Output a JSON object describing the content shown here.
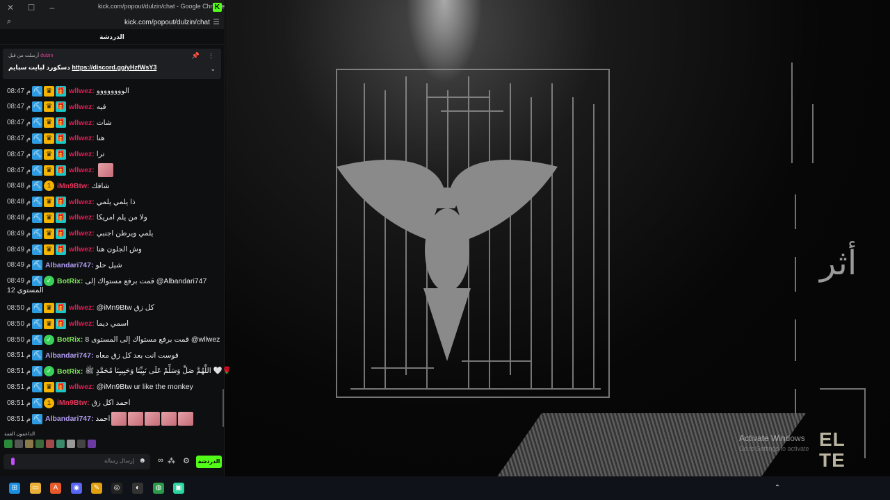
{
  "window": {
    "title": "kick.com/popout/dulzin/chat - Google Chrome",
    "url": "kick.com/popout/dulzin/chat"
  },
  "chat": {
    "header": "الدردشة",
    "pinned": {
      "by_label": "أرسلت من قبل",
      "by_user": "dulzin",
      "text": "دسكورد لبايت سبايم",
      "link": "https://discord.gg/yHzfWsY3"
    },
    "messages": [
      {
        "time": "08:47 م",
        "user": "wllwez",
        "text": "الوووووووو",
        "badges": [
          "pick",
          "crown",
          "gift"
        ]
      },
      {
        "time": "08:47 م",
        "user": "wllwez",
        "text": "فيه",
        "badges": [
          "pick",
          "crown",
          "gift"
        ]
      },
      {
        "time": "08:47 م",
        "user": "wllwez",
        "text": "شات",
        "badges": [
          "pick",
          "crown",
          "gift"
        ]
      },
      {
        "time": "08:47 م",
        "user": "wllwez",
        "text": "هنا",
        "badges": [
          "pick",
          "crown",
          "gift"
        ]
      },
      {
        "time": "08:47 م",
        "user": "wllwez",
        "text": "ترا",
        "badges": [
          "pick",
          "crown",
          "gift"
        ]
      },
      {
        "time": "08:47 م",
        "user": "wllwez",
        "text": "",
        "badges": [
          "pick",
          "crown",
          "gift"
        ],
        "emotes": 1
      },
      {
        "time": "08:48 م",
        "user": "iMn9Btw",
        "text": "شافك",
        "badges": [
          "pick",
          "coin"
        ]
      },
      {
        "time": "08:48 م",
        "user": "wllwez",
        "text": "ذا يلمي يلمي",
        "badges": [
          "pick",
          "crown",
          "gift"
        ]
      },
      {
        "time": "08:48 م",
        "user": "wllwez",
        "text": "ولا من يلم امريكا",
        "badges": [
          "pick",
          "crown",
          "gift"
        ]
      },
      {
        "time": "08:49 م",
        "user": "wllwez",
        "text": "يلمي ويرطن اجنبي",
        "badges": [
          "pick",
          "crown",
          "gift"
        ]
      },
      {
        "time": "08:49 م",
        "user": "wllwez",
        "text": "وش الجلون هنا",
        "badges": [
          "pick",
          "crown",
          "gift"
        ]
      },
      {
        "time": "08:49 م",
        "user": "Albandari747",
        "text": "شيل حلو",
        "badges": [
          "pick"
        ]
      },
      {
        "time": "08:49 م",
        "user": "BotRix",
        "text": "قمت برفع مستواك إلى @Albandari747",
        "text2": "المستوى 12",
        "badges": [
          "pick",
          "verified"
        ]
      },
      {
        "time": "08:50 م",
        "user": "wllwez",
        "text": "@iMn9Btw كل زق",
        "badges": [
          "pick",
          "crown",
          "gift"
        ]
      },
      {
        "time": "08:50 م",
        "user": "wllwez",
        "text": "اسمي ديما",
        "badges": [
          "pick",
          "crown",
          "gift"
        ]
      },
      {
        "time": "08:50 م",
        "user": "BotRix",
        "text": "قمت برفع مستواك إلى المستوى 8 @wllwez",
        "badges": [
          "pick",
          "verified"
        ]
      },
      {
        "time": "08:51 م",
        "user": "Albandari747",
        "text": "قوست انت بعد كل زق معاه",
        "badges": [
          "pick"
        ]
      },
      {
        "time": "08:51 م",
        "user": "BotRix",
        "text": "اللَّهُمَّ صَلِّ وَسَلِّمْ عَلَى نَبِيِّنَا وَحَبِيبِنَا مُحَمَّدٍ ﷺ 🤍🌹",
        "badges": [
          "pick",
          "verified"
        ]
      },
      {
        "time": "08:51 م",
        "user": "wllwez",
        "text": "@iMn9Btw ur like the monkey",
        "badges": [
          "pick",
          "crown",
          "gift"
        ]
      },
      {
        "time": "08:51 م",
        "user": "iMn9Btw",
        "text": "احمد اكل زق",
        "badges": [
          "pick",
          "coin"
        ]
      },
      {
        "time": "08:51 م",
        "user": "Albandari747",
        "text": "احمد",
        "badges": [
          "pick"
        ],
        "emotes": 5
      }
    ],
    "supporters_label": "الداعمون القمة",
    "composer_placeholder": "إرسال رسالة",
    "send_label": "الدردشة"
  },
  "stream": {
    "watermark_title": "Activate Windows",
    "watermark_sub": "Go to Settings to activate",
    "logo_text": "ELITE"
  },
  "colors": {
    "kick_green": "#53fc18",
    "user_wllwez": "#e01d54",
    "user_albandari": "#b19cf0",
    "user_botrix": "#7de35b"
  }
}
